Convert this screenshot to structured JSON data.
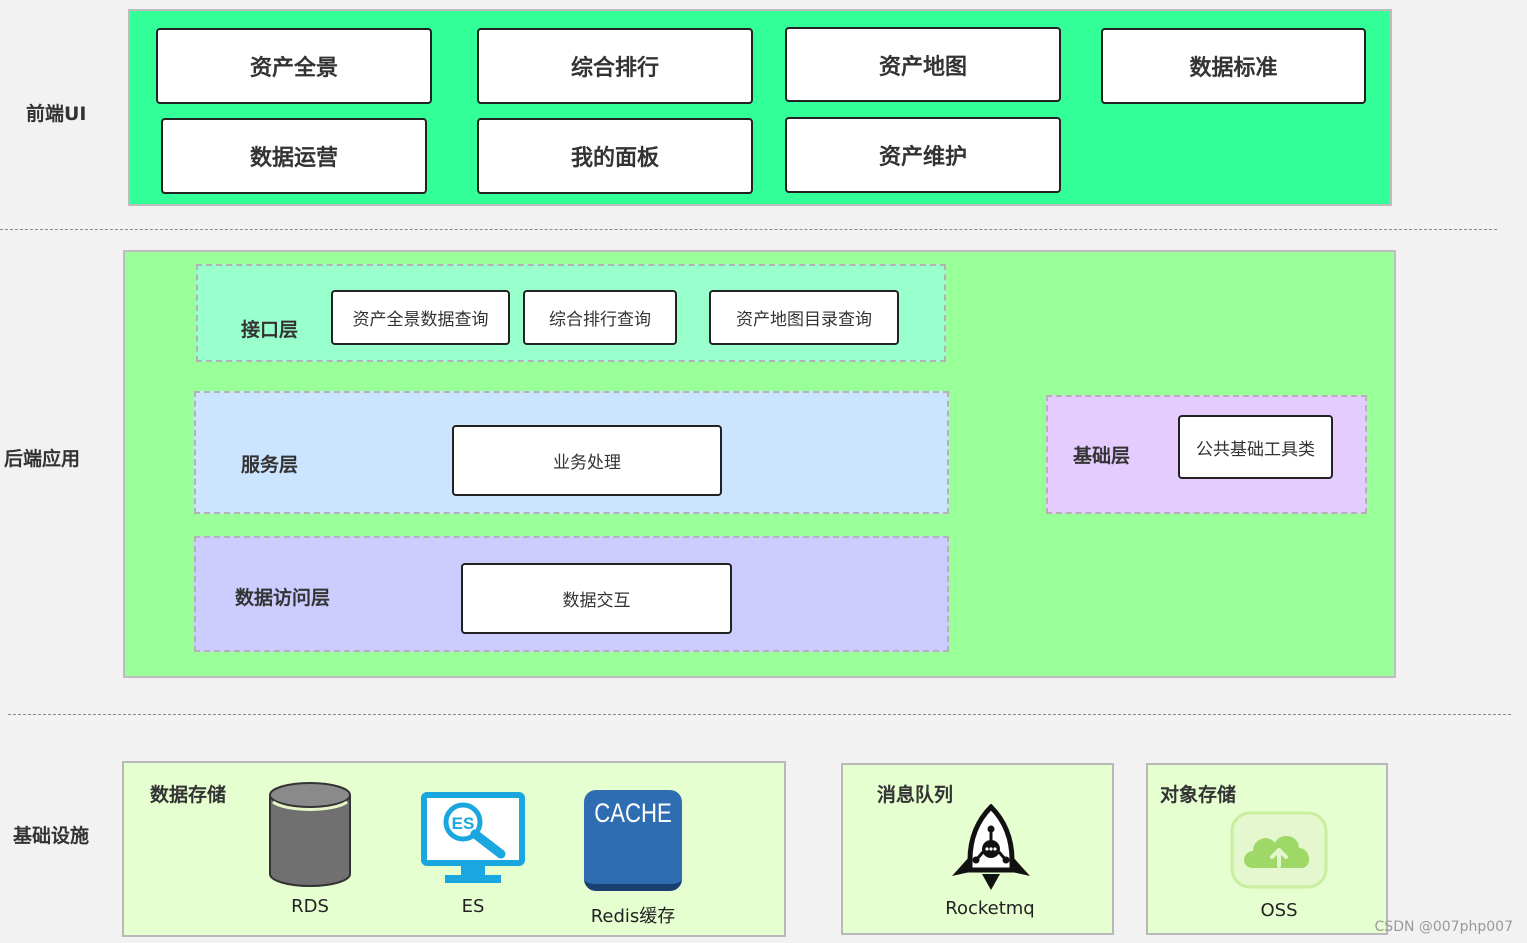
{
  "sections": {
    "frontend": "前端UI",
    "backend": "后端应用",
    "infrastructure": "基础设施"
  },
  "frontend_modules": [
    "资产全景",
    "综合排行",
    "资产地图",
    "数据标准",
    "数据运营",
    "我的面板",
    "资产维护"
  ],
  "backend": {
    "interface_layer": {
      "label": "接口层",
      "items": [
        "资产全景数据查询",
        "综合排行查询",
        "资产地图目录查询"
      ]
    },
    "service_layer": {
      "label": "服务层",
      "item": "业务处理"
    },
    "data_access_layer": {
      "label": "数据访问层",
      "item": "数据交互"
    },
    "foundation_layer": {
      "label": "基础层",
      "item": "公共基础工具类"
    }
  },
  "infrastructure": {
    "storage": {
      "title": "数据存储",
      "items": [
        {
          "label": "RDS",
          "icon": "database-cylinder-icon"
        },
        {
          "label": "ES",
          "icon": "elasticsearch-monitor-icon"
        },
        {
          "label": "Redis缓存",
          "icon": "cache-icon",
          "badge": "CACHE"
        }
      ]
    },
    "mq": {
      "title": "消息队列",
      "label": "Rocketmq",
      "icon": "rocket-icon"
    },
    "object_storage": {
      "title": "对象存储",
      "label": "OSS",
      "icon": "cloud-upload-icon"
    }
  },
  "colors": {
    "frontend_bg": "#33ff99",
    "backend_bg": "#99ff99",
    "interface_bg": "#99ffcc",
    "service_bg": "#cce5ff",
    "data_access_bg": "#ccccff",
    "foundation_bg": "#e5ccff",
    "infra_bg": "#e6ffd0"
  },
  "watermark": "CSDN @007php007"
}
